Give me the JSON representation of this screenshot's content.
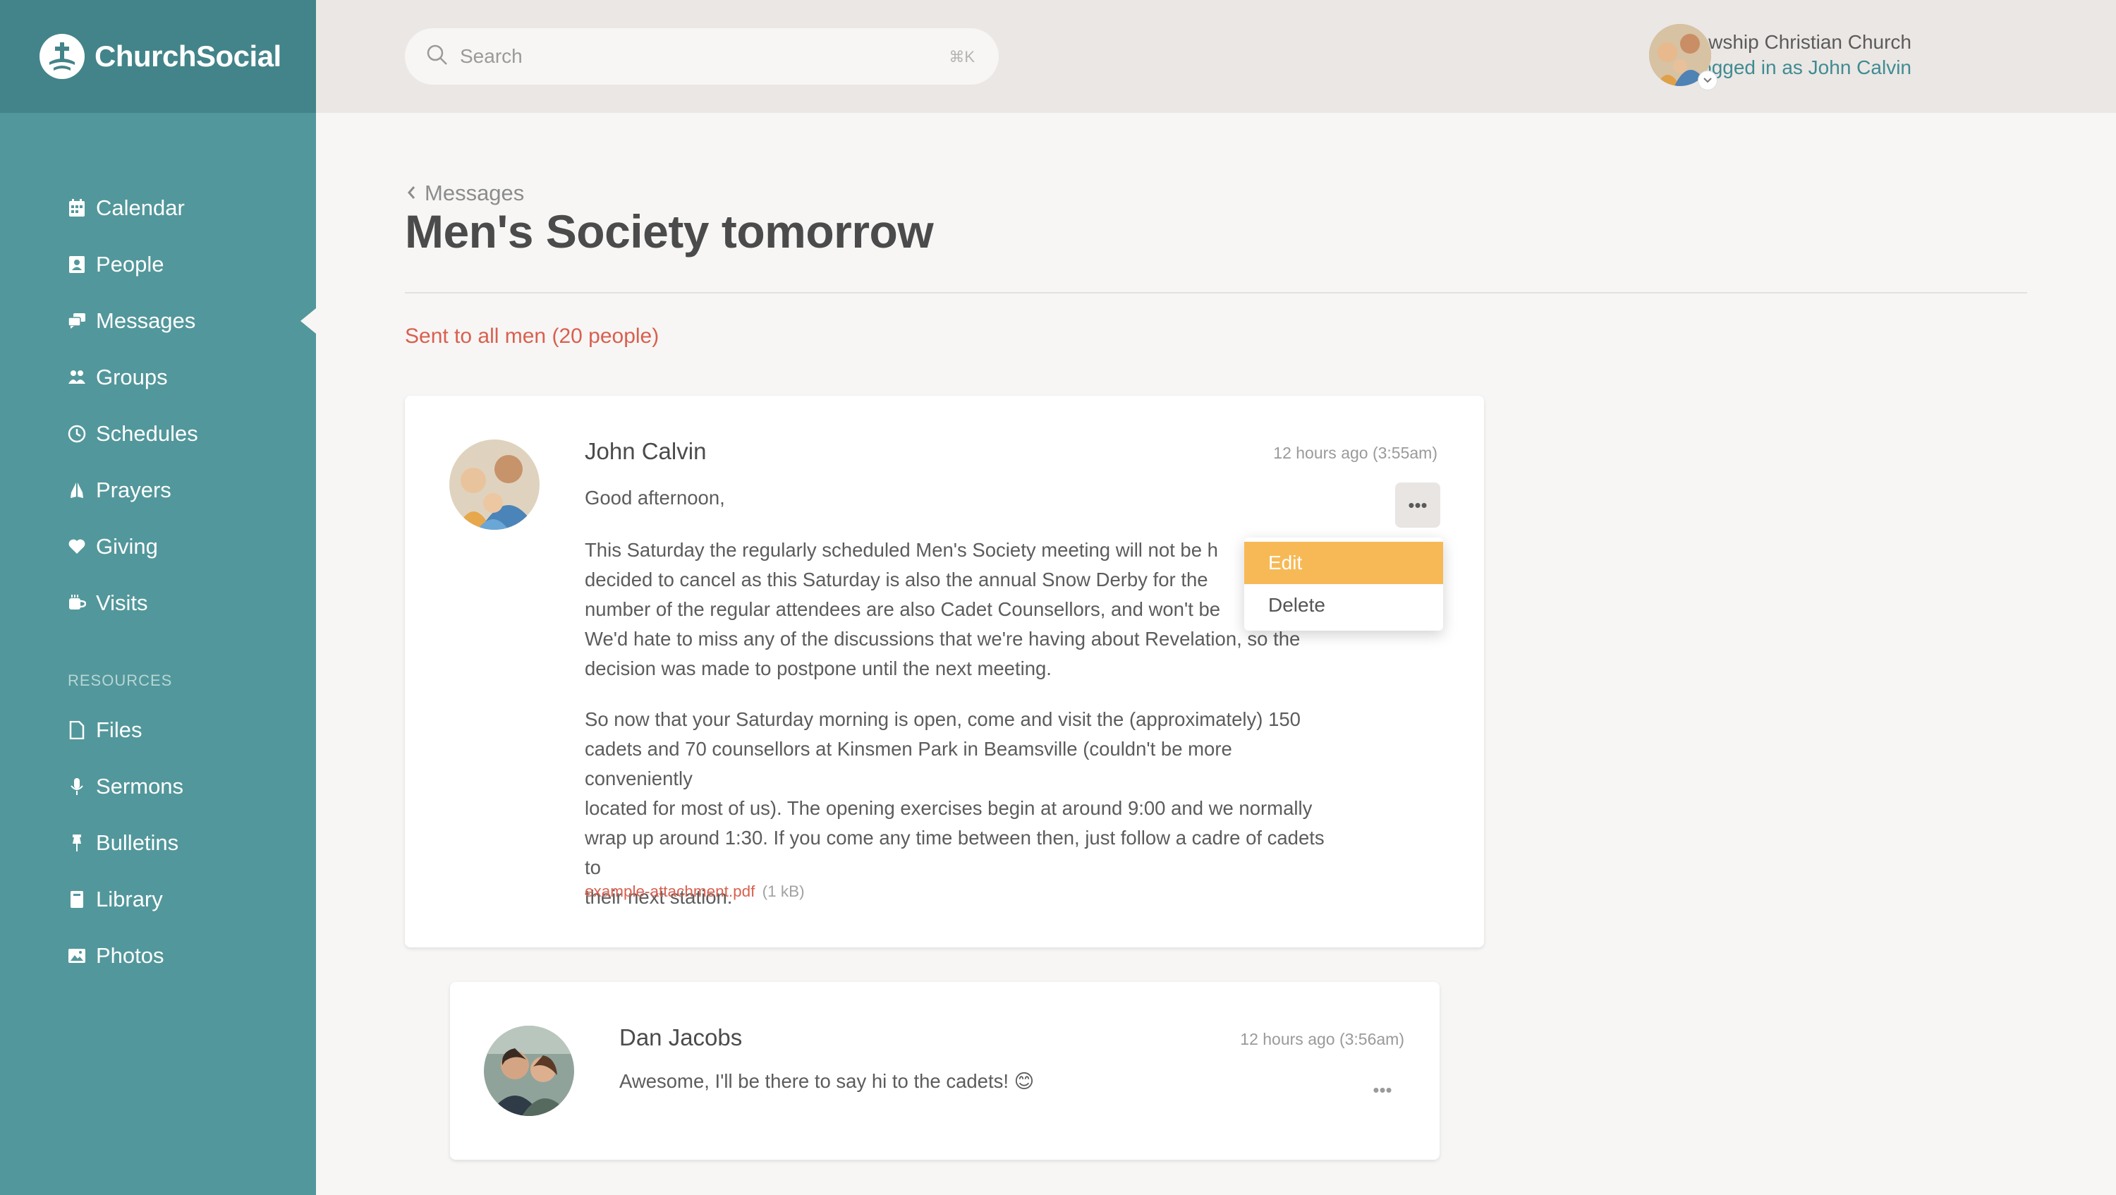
{
  "brand": {
    "name": "ChurchSocial"
  },
  "sidebar": {
    "items": [
      {
        "label": "Calendar",
        "icon": "calendar-icon"
      },
      {
        "label": "People",
        "icon": "person-icon"
      },
      {
        "label": "Messages",
        "icon": "messages-icon",
        "active": true
      },
      {
        "label": "Groups",
        "icon": "groups-icon"
      },
      {
        "label": "Schedules",
        "icon": "clock-icon"
      },
      {
        "label": "Prayers",
        "icon": "praying-hands-icon"
      },
      {
        "label": "Giving",
        "icon": "heart-icon"
      },
      {
        "label": "Visits",
        "icon": "coffee-cup-icon"
      }
    ],
    "resources_heading": "RESOURCES",
    "resources": [
      {
        "label": "Files",
        "icon": "file-icon"
      },
      {
        "label": "Sermons",
        "icon": "microphone-icon"
      },
      {
        "label": "Bulletins",
        "icon": "pin-icon"
      },
      {
        "label": "Library",
        "icon": "book-icon"
      },
      {
        "label": "Photos",
        "icon": "image-icon"
      }
    ]
  },
  "topbar": {
    "search_placeholder": "Search",
    "search_shortcut": "⌘K",
    "church_name": "Fellowship Christian Church",
    "logged_in_as": "Logged in as John Calvin"
  },
  "page": {
    "breadcrumb": "Messages",
    "title": "Men's Society tomorrow",
    "recipients": "Sent to all men (20 people)"
  },
  "message": {
    "author": "John Calvin",
    "time": "12 hours ago (3:55am)",
    "greeting": "Good afternoon,",
    "para1_lines": [
      "This Saturday the regularly scheduled Men's Society meeting will not be h",
      "decided to cancel as this Saturday is also the annual Snow Derby for the",
      "number of the regular attendees are also Cadet Counsellors, and won't be",
      "We'd hate to miss any of the discussions that we're having about Revelation, so the",
      "decision was made to postpone until the next meeting."
    ],
    "para2_lines": [
      "So now that your Saturday morning is open, come and visit the (approximately) 150",
      "cadets and 70 counsellors at Kinsmen Park in Beamsville (couldn't be more conveniently",
      "located for most of us). The opening exercises begin at around 9:00 and we normally",
      "wrap up around 1:30. If you come any time between then, just follow a cadre of cadets to",
      "their next station."
    ],
    "attachment_name": "example-attachment.pdf",
    "attachment_size": "(1 kB)",
    "more_label": "•••",
    "menu": {
      "edit": "Edit",
      "delete": "Delete"
    }
  },
  "reply": {
    "author": "Dan Jacobs",
    "time": "12 hours ago (3:56am)",
    "text": "Awesome, I'll be there to say hi to the cadets! 😊",
    "more_label": "•••"
  },
  "colors": {
    "sidebar": "#52979b",
    "brand_bar": "#428489",
    "accent_link": "#d9604f",
    "menu_highlight": "#f7b955",
    "topbar": "#ebe7e5"
  }
}
